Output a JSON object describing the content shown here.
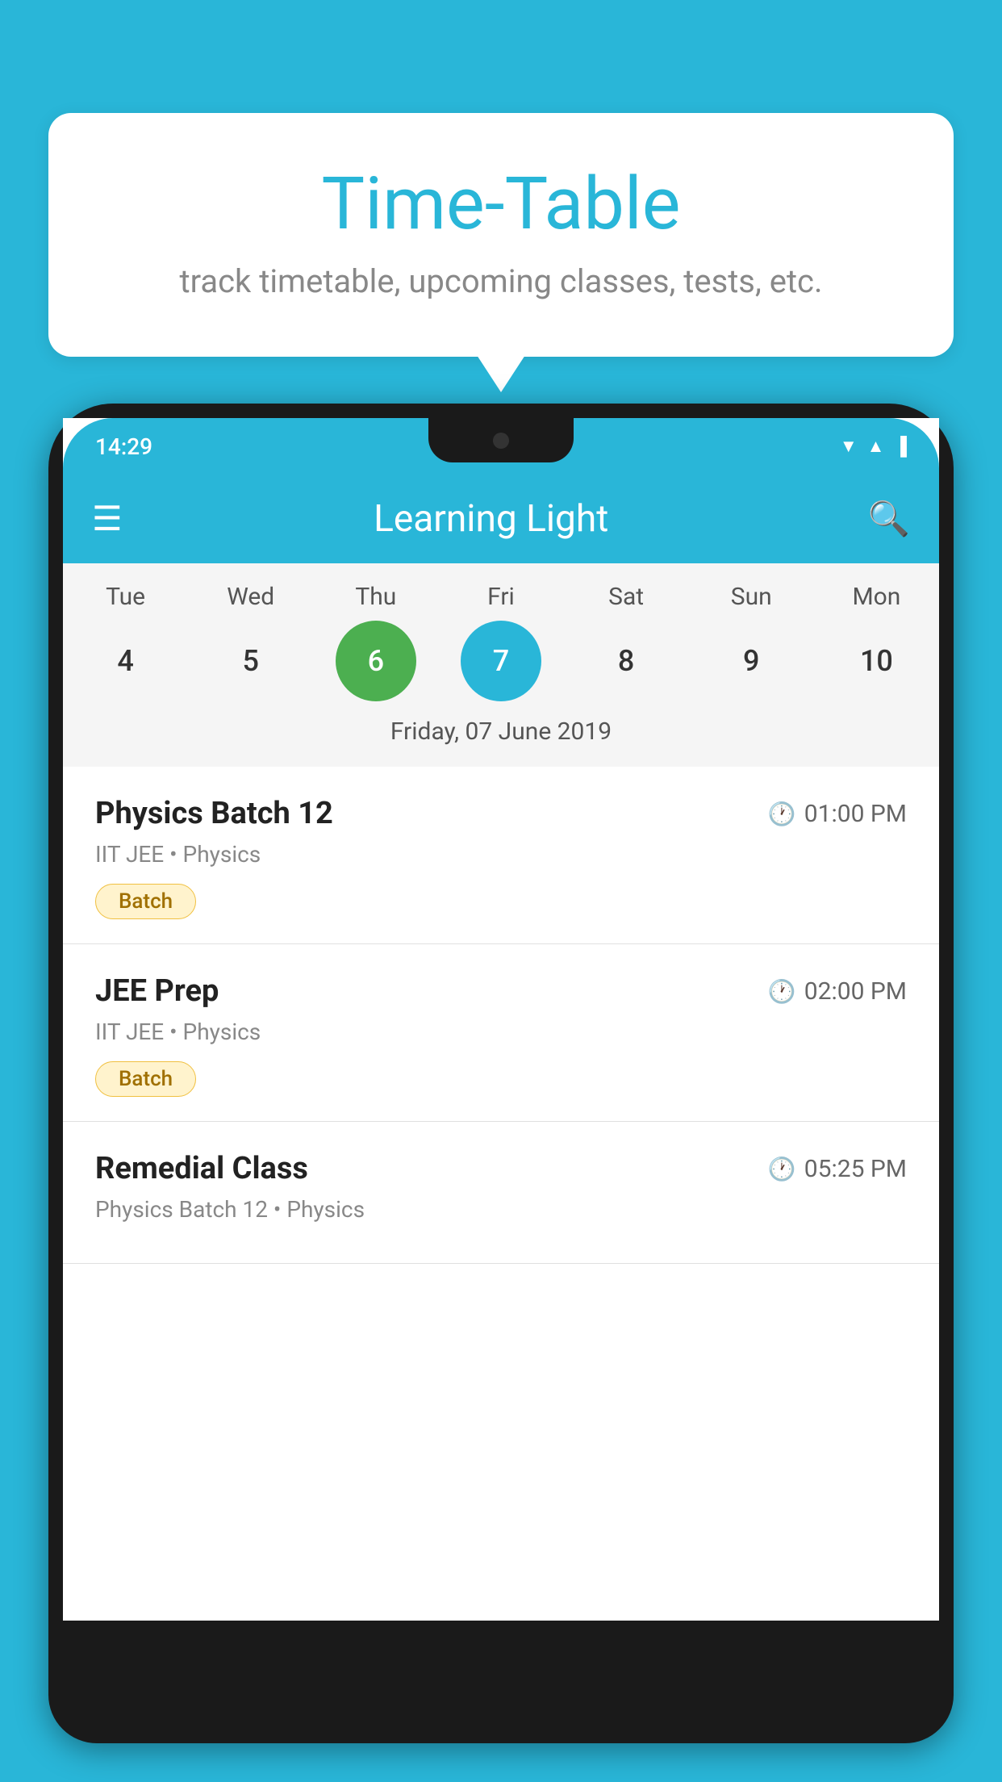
{
  "background_color": "#29B6D8",
  "bubble": {
    "title": "Time-Table",
    "subtitle": "track timetable, upcoming classes, tests, etc."
  },
  "phone": {
    "status_time": "14:29",
    "app_name": "Learning Light"
  },
  "calendar": {
    "days": [
      {
        "name": "Tue",
        "number": "4",
        "state": "normal"
      },
      {
        "name": "Wed",
        "number": "5",
        "state": "normal"
      },
      {
        "name": "Thu",
        "number": "6",
        "state": "today"
      },
      {
        "name": "Fri",
        "number": "7",
        "state": "selected"
      },
      {
        "name": "Sat",
        "number": "8",
        "state": "normal"
      },
      {
        "name": "Sun",
        "number": "9",
        "state": "normal"
      },
      {
        "name": "Mon",
        "number": "10",
        "state": "normal"
      }
    ],
    "selected_date_label": "Friday, 07 June 2019"
  },
  "schedule": [
    {
      "title": "Physics Batch 12",
      "time": "01:00 PM",
      "sub": "IIT JEE • Physics",
      "badge": "Batch"
    },
    {
      "title": "JEE Prep",
      "time": "02:00 PM",
      "sub": "IIT JEE • Physics",
      "badge": "Batch"
    },
    {
      "title": "Remedial Class",
      "time": "05:25 PM",
      "sub": "Physics Batch 12 • Physics",
      "badge": ""
    }
  ],
  "icons": {
    "menu": "≡",
    "search": "🔍",
    "clock": "🕐"
  }
}
